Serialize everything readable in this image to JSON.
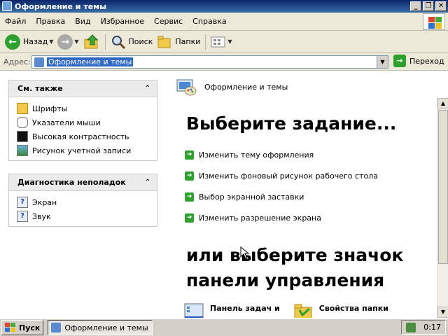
{
  "window": {
    "title": "Оформление и темы",
    "buttons": [
      "_",
      "❐",
      "✕"
    ]
  },
  "menu": [
    "Файл",
    "Правка",
    "Вид",
    "Избранное",
    "Сервис",
    "Справка"
  ],
  "toolbar": {
    "back_label": "Назад",
    "search_label": "Поиск",
    "folders_label": "Папки"
  },
  "address": {
    "label": "Адрес:",
    "value": "Оформление и темы",
    "go_label": "Переход"
  },
  "see_also": {
    "title": "См. также",
    "items": [
      {
        "label": "Шрифты",
        "icon": "folder-fonts-icon"
      },
      {
        "label": "Указатели мыши",
        "icon": "mouse-icon"
      },
      {
        "label": "Высокая контрастность",
        "icon": "contrast-icon"
      },
      {
        "label": "Рисунок учетной записи",
        "icon": "user-picture-icon"
      }
    ]
  },
  "troubleshoot": {
    "title": "Диагностика неполадок",
    "items": [
      {
        "label": "Экран",
        "icon": "help-icon"
      },
      {
        "label": "Звук",
        "icon": "help-icon"
      }
    ]
  },
  "main": {
    "header": "Оформление и темы",
    "pick_task": "Выберите задание...",
    "tasks": [
      "Изменить тему оформления",
      "Изменить фоновый рисунок рабочего стола",
      "Выбор экранной заставки",
      "Изменить разрешение экрана"
    ],
    "pick_icon_line1": "или выберите значок",
    "pick_icon_line2": "панели управления",
    "cp_items": [
      "Панель задач и",
      "Свойства папки"
    ]
  },
  "taskbar": {
    "start_label": "Пуск",
    "window_label": "Оформление и темы",
    "clock": "0:17"
  },
  "colors": {
    "title_bar": "#0a246a",
    "chrome": "#ece9d8",
    "task_arrow": "#2ea02e",
    "selection": "#316ac5"
  }
}
